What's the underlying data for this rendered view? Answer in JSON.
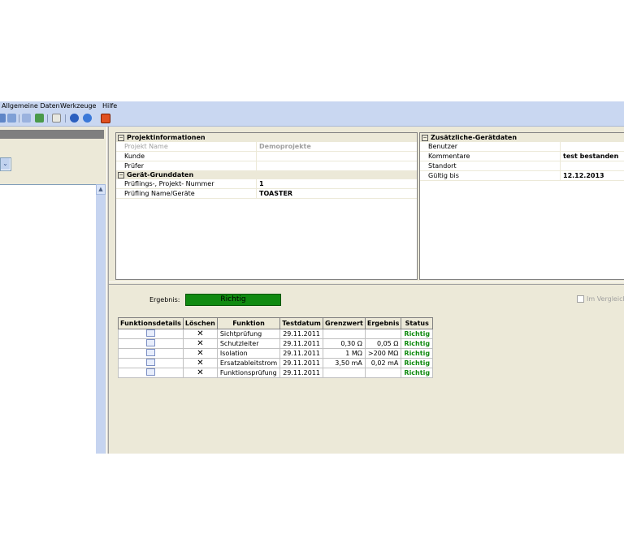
{
  "menu": [
    "Allgemeine Daten",
    "Werkzeuge",
    "Hilfe"
  ],
  "toolbar_icons": [
    "back-icon",
    "forward-icon",
    "refresh-icon",
    "grid-icon",
    "document-icon",
    "help-icon",
    "info-icon",
    "exit-icon"
  ],
  "left_panel": {
    "combo_arrow": "⌄",
    "scroll_up": "▲"
  },
  "project_grid": {
    "sections": [
      {
        "title": "Projektinformationen",
        "rows": [
          {
            "key": "Projekt Name",
            "value": "Demoprojekte",
            "disabled": true
          },
          {
            "key": "Kunde",
            "value": ""
          },
          {
            "key": "Prüfer",
            "value": ""
          }
        ]
      },
      {
        "title": "Gerät-Grunddaten",
        "rows": [
          {
            "key": "Prüflings-, Projekt- Nummer",
            "value": "1"
          },
          {
            "key": "Prüfling Name/Geräte",
            "value": "TOASTER"
          }
        ]
      }
    ]
  },
  "extra_grid": {
    "title": "Zusätzliche-Gerätdaten",
    "rows": [
      {
        "key": "Benutzer",
        "value": ""
      },
      {
        "key": "Kommentare",
        "value": "test bestanden"
      },
      {
        "key": "Standort",
        "value": ""
      },
      {
        "key": "Gültig bis",
        "value": "12.12.2013"
      }
    ]
  },
  "result": {
    "label": "Ergebnis:",
    "value": "Richtig",
    "compare_label": "Im Vergleich n"
  },
  "table": {
    "headers": [
      "Funktionsdetails",
      "Löschen",
      "Funktion",
      "Testdatum",
      "Grenzwert",
      "Ergebnis",
      "Status"
    ],
    "rows": [
      {
        "funktion": "Sichtprüfung",
        "datum": "29.11.2011",
        "grenzwert": "",
        "ergebnis": "",
        "status": "Richtig"
      },
      {
        "funktion": "Schutzleiter",
        "datum": "29.11.2011",
        "grenzwert": "0,30 Ω",
        "ergebnis": "0,05 Ω",
        "status": "Richtig"
      },
      {
        "funktion": "Isolation",
        "datum": "29.11.2011",
        "grenzwert": "1 MΩ",
        "ergebnis": ">200 MΩ",
        "status": "Richtig"
      },
      {
        "funktion": "Ersatzableitstrom",
        "datum": "29.11.2011",
        "grenzwert": "3,50 mA",
        "ergebnis": "0,02 mA",
        "status": "Richtig"
      },
      {
        "funktion": "Funktionsprüfung",
        "datum": "29.11.2011",
        "grenzwert": "",
        "ergebnis": "",
        "status": "Richtig"
      }
    ],
    "delete_glyph": "✕"
  },
  "colors": {
    "accent_green": "#108a10",
    "menubar": "#c9d7f1"
  }
}
